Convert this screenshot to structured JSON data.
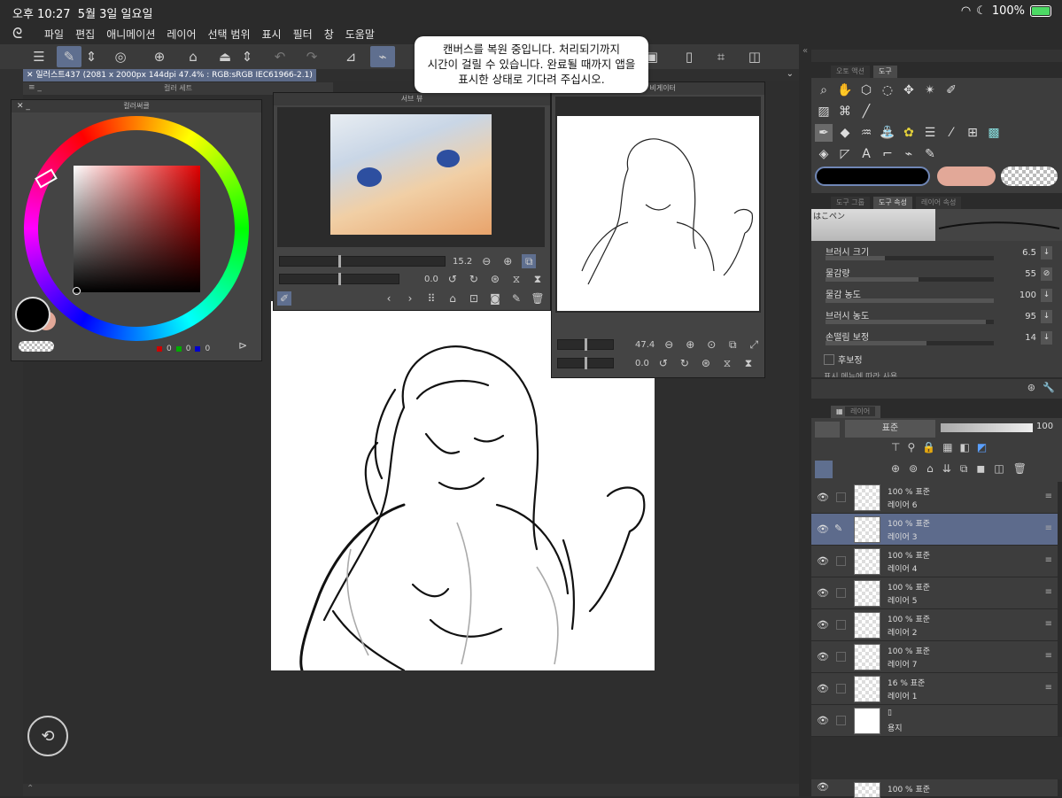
{
  "status_bar": {
    "time": "오후 10:27",
    "date": "5월 3일 일요일",
    "battery": "100%"
  },
  "menu": {
    "items": [
      "파일",
      "편집",
      "애니메이션",
      "레이어",
      "선택 범위",
      "표시",
      "필터",
      "창",
      "도움말"
    ]
  },
  "document": {
    "tab_title": "일러스트437 (2081 x 2000px 144dpi 47.4% : RGB:sRGB IEC61966-2.1)"
  },
  "toast": {
    "line1": "캔버스를 복원 중입니다. 처리되기까지",
    "line2": "시간이 걸릴 수 있습니다. 완료될 때까지 앱을",
    "line3": "표시한 상태로 기다려 주십시오."
  },
  "color_set": {
    "title": "컬러 세트"
  },
  "color_wheel": {
    "title": "컬러써클",
    "r": "0",
    "g": "0",
    "b": "0",
    "main_color": "#000000",
    "sub_color": "#e2a898"
  },
  "sub_view": {
    "title": "서브 뷰",
    "zoom": "15.2",
    "angle": "0.0"
  },
  "navigator": {
    "title": "비게이터",
    "zoom": "47.4",
    "angle": "0.0"
  },
  "tool_panel": {
    "tab1": "오토 액션",
    "tab2": "도구"
  },
  "tool_property": {
    "tab1": "도구 그룹",
    "tab2": "도구 속성",
    "tab3": "레이어 속성",
    "brush_name": "はこペン",
    "props": [
      {
        "label": "브러시 크기",
        "value": "6.5",
        "fill": 0.35
      },
      {
        "label": "물감량",
        "value": "55",
        "fill": 0.55
      },
      {
        "label": "물감 농도",
        "value": "100",
        "fill": 1.0
      },
      {
        "label": "브러시 농도",
        "value": "95",
        "fill": 0.95
      },
      {
        "label": "손떨림 보정",
        "value": "14",
        "fill": 0.6
      }
    ],
    "post_correction": "후보정",
    "footer_text": "표시 메뉴에 따라 사용"
  },
  "layer_panel": {
    "title": "레이어",
    "blend_mode": "표준",
    "opacity": "100",
    "layers": [
      {
        "opacity_mode": "100 % 표준",
        "name": "레이어 6"
      },
      {
        "opacity_mode": "100 % 표준",
        "name": "레이어 3",
        "selected": true
      },
      {
        "opacity_mode": "100 % 표준",
        "name": "레이어 4"
      },
      {
        "opacity_mode": "100 % 표준",
        "name": "레이어 5"
      },
      {
        "opacity_mode": "100 % 표준",
        "name": "레이어 2"
      },
      {
        "opacity_mode": "100 % 표준",
        "name": "레이어 7"
      },
      {
        "opacity_mode": "16 % 표준",
        "name": "레이어 1"
      },
      {
        "opacity_mode": "",
        "name": "용지"
      }
    ],
    "bottom_layer": {
      "opacity_mode": "100 % 표준"
    }
  }
}
